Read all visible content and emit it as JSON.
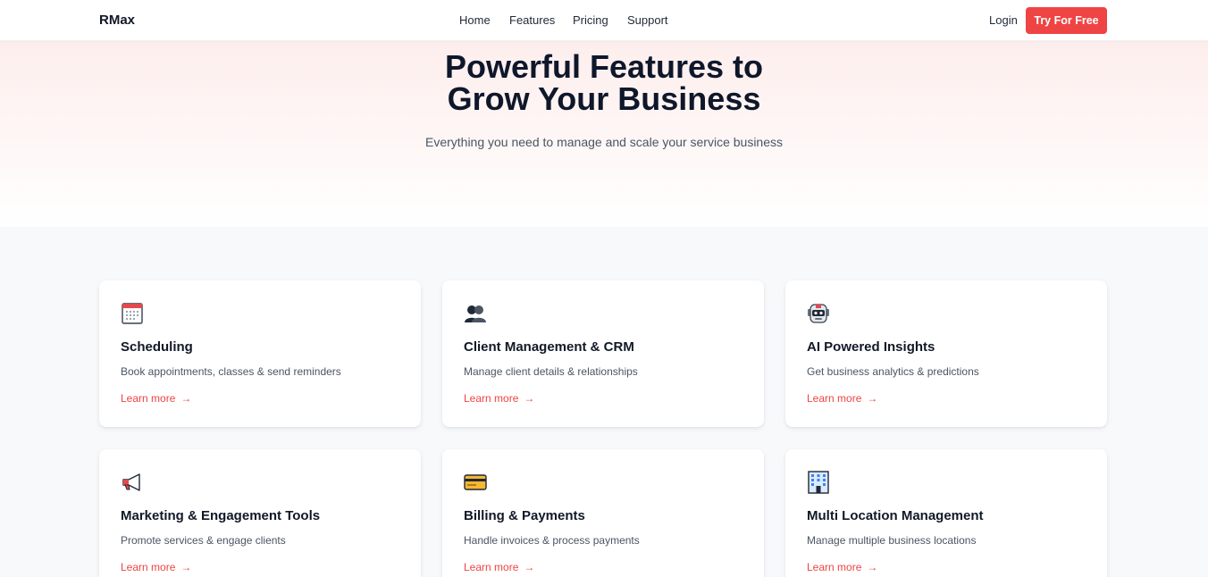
{
  "nav": {
    "brand": "RMax",
    "links": [
      "Home",
      "Features",
      "Pricing",
      "Support"
    ],
    "login": "Login",
    "cta": "Try For Free"
  },
  "hero": {
    "title_line1": "Powerful Features to",
    "title_line2": "Grow Your Business",
    "subtitle": "Everything you need to manage and scale your service business"
  },
  "features": [
    {
      "icon": "calendar-icon",
      "title": "Scheduling",
      "description": "Book appointments, classes & send reminders",
      "link": "Learn more"
    },
    {
      "icon": "people-icon",
      "title": "Client Management & CRM",
      "description": "Manage client details & relationships",
      "link": "Learn more"
    },
    {
      "icon": "robot-icon",
      "title": "AI Powered Insights",
      "description": "Get business analytics & predictions",
      "link": "Learn more"
    },
    {
      "icon": "megaphone-icon",
      "title": "Marketing & Engagement Tools",
      "description": "Promote services & engage clients",
      "link": "Learn more"
    },
    {
      "icon": "credit-card-icon",
      "title": "Billing & Payments",
      "description": "Handle invoices & process payments",
      "link": "Learn more"
    },
    {
      "icon": "office-building-icon",
      "title": "Multi Location Management",
      "description": "Manage multiple business locations",
      "link": "Learn more"
    }
  ],
  "colors": {
    "accent": "#ef4444",
    "heading": "#0f172a",
    "hero_bg": "#fdeeed",
    "section_bg": "#f8f9fb"
  }
}
